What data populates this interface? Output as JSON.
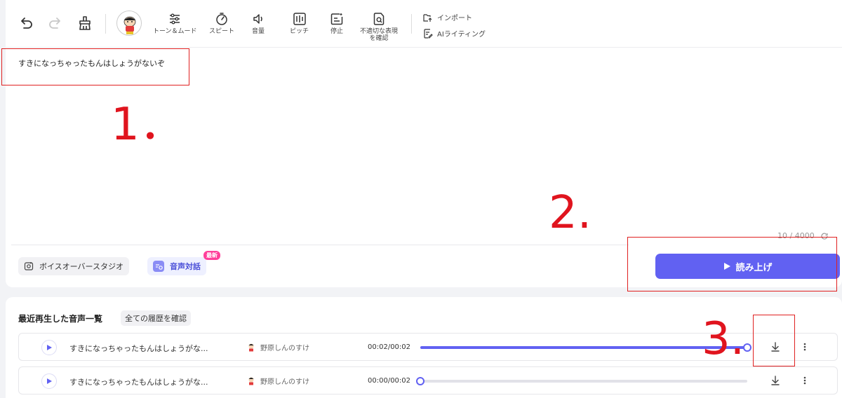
{
  "toolbar": {
    "tone_label": "トーン＆ムード",
    "speed_label": "スピート",
    "volume_label": "音量",
    "pitch_label": "ピッチ",
    "pause_label": "停止",
    "check_label_1": "不適切な表現",
    "check_label_2": "を確認",
    "import_label": "インポート",
    "ai_writing_label": "AIライティング"
  },
  "editor": {
    "text": "すきになっちゃったもんはしょうがないぞ",
    "counter": "10 / 4000"
  },
  "annotations": {
    "n1": "1．",
    "n2": "2.",
    "n3": "3."
  },
  "controls": {
    "voiceover_label": "ボイスオーバースタジオ",
    "voice_chat_label": "音声対話",
    "new_badge": "最新",
    "read_button": "読み上げ"
  },
  "history": {
    "title": "最近再生した音声一覧",
    "view_all": "全ての履歴を確認",
    "rows": [
      {
        "text": "すきになっちゃったもんはしょうがな...",
        "voice": "野原しんのすけ",
        "time": "00:02/00:02",
        "progress": 1.0
      },
      {
        "text": "すきになっちゃったもんはしょうがな...",
        "voice": "野原しんのすけ",
        "time": "00:00/00:02",
        "progress": 0.0
      }
    ]
  },
  "colors": {
    "accent": "#6161f2",
    "annotation_red": "#e0141e",
    "badge_pink": "#ff3f9a"
  }
}
